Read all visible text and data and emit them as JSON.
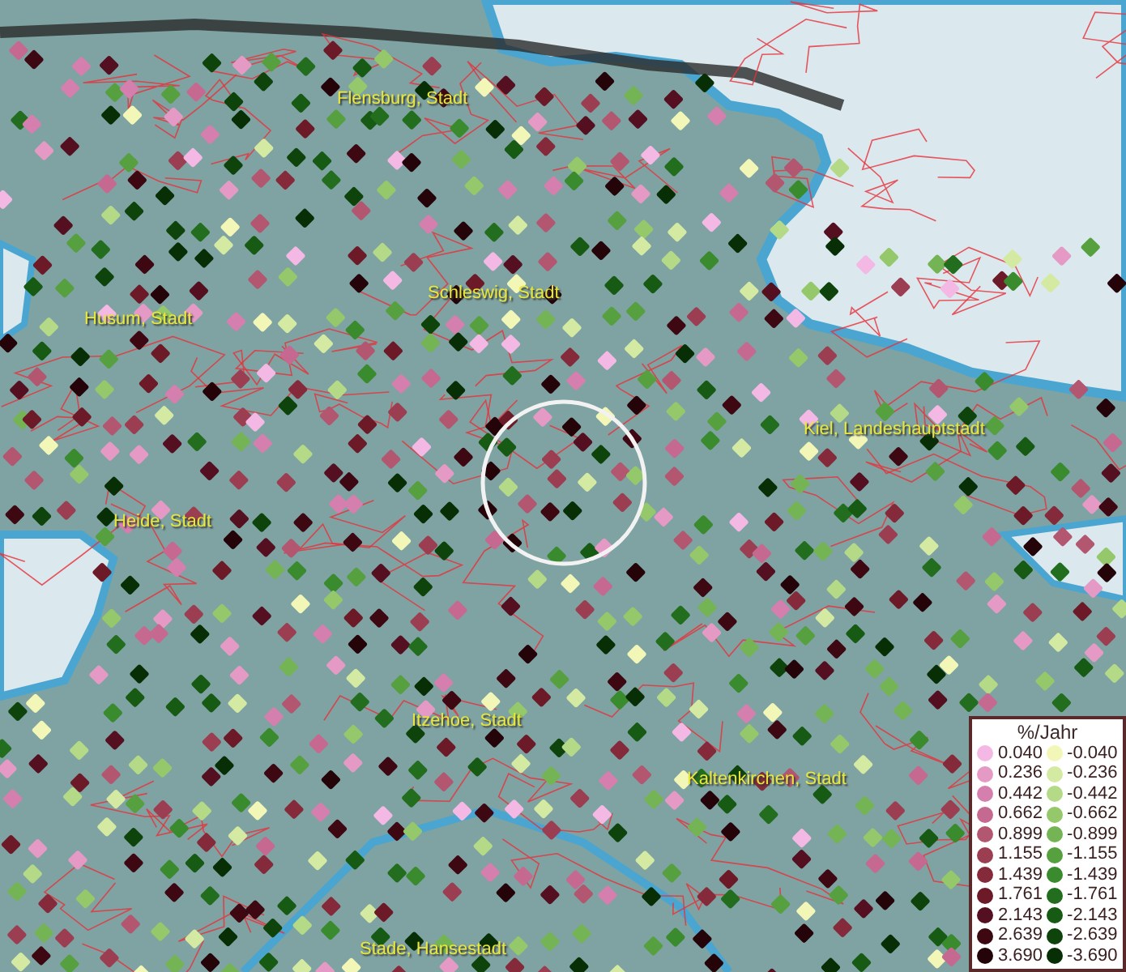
{
  "map": {
    "places": [
      {
        "label": "Flensburg, Stadt"
      },
      {
        "label": "Schleswig, Stadt"
      },
      {
        "label": "Husum, Stadt"
      },
      {
        "label": "Kiel, Landeshauptstadt"
      },
      {
        "label": "Heide, Stadt"
      },
      {
        "label": "Itzehoe, Stadt"
      },
      {
        "label": "Kaltenkirchen, Stadt"
      },
      {
        "label": "Stade, Hansestadt"
      }
    ]
  },
  "legend": {
    "title": "%/Jahr",
    "columns": [
      [
        {
          "label": "0.040",
          "color": "#f4b8e4"
        },
        {
          "label": "0.236",
          "color": "#e59ac6"
        },
        {
          "label": "0.442",
          "color": "#d47fae"
        },
        {
          "label": "0.662",
          "color": "#c56990"
        },
        {
          "label": "0.899",
          "color": "#b3566f"
        },
        {
          "label": "1.155",
          "color": "#9c3e52"
        },
        {
          "label": "1.439",
          "color": "#852a3a"
        },
        {
          "label": "1.761",
          "color": "#6d1a28"
        },
        {
          "label": "2.143",
          "color": "#541020"
        },
        {
          "label": "2.639",
          "color": "#3d0812"
        },
        {
          "label": "3.690",
          "color": "#240408"
        }
      ],
      [
        {
          "label": "-0.040",
          "color": "#f2f7b8"
        },
        {
          "label": "-0.236",
          "color": "#d4eaa2"
        },
        {
          "label": "-0.442",
          "color": "#b4da88"
        },
        {
          "label": "-0.662",
          "color": "#94c86a"
        },
        {
          "label": "-0.899",
          "color": "#74b454"
        },
        {
          "label": "-1.155",
          "color": "#56a040"
        },
        {
          "label": "-1.439",
          "color": "#3a8a2e"
        },
        {
          "label": "-1.761",
          "color": "#226e1e"
        },
        {
          "label": "-2.143",
          "color": "#165a14"
        },
        {
          "label": "-2.639",
          "color": "#0e440c"
        },
        {
          "label": "-3.690",
          "color": "#082e06"
        }
      ]
    ]
  }
}
